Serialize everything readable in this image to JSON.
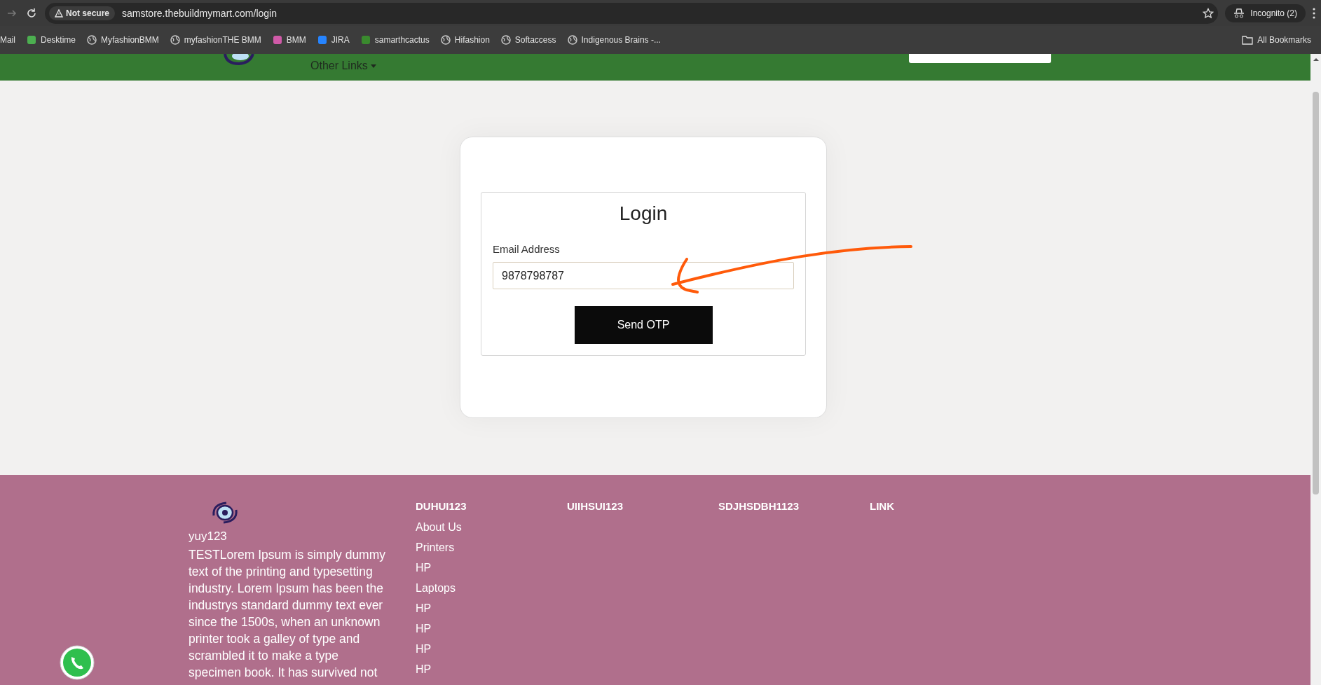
{
  "browser": {
    "security_label": "Not secure",
    "url": "samstore.thebuildmymart.com/login",
    "profile_label": "Incognito (2)",
    "bookmarks": [
      {
        "label": "Mail",
        "kind": "none"
      },
      {
        "label": "Desktime",
        "kind": "favicon",
        "color": "#4caf50"
      },
      {
        "label": "MyfashionBMM",
        "kind": "globe"
      },
      {
        "label": "myfashionTHE BMM",
        "kind": "globe"
      },
      {
        "label": "BMM",
        "kind": "favicon",
        "color": "#d05aa8"
      },
      {
        "label": "JIRA",
        "kind": "favicon",
        "color": "#2684ff"
      },
      {
        "label": "samarthcactus",
        "kind": "favicon",
        "color": "#3a8a2e"
      },
      {
        "label": "Hifashion",
        "kind": "globe"
      },
      {
        "label": "Softaccess",
        "kind": "globe"
      },
      {
        "label": "Indigenous Brains -...",
        "kind": "globe"
      }
    ],
    "all_bookmarks_label": "All Bookmarks"
  },
  "header": {
    "menu_label": "Other Links"
  },
  "login": {
    "title": "Login",
    "email_label": "Email Address",
    "email_value": "9878798787",
    "submit_label": "Send OTP"
  },
  "footer": {
    "brand": "yuy123",
    "description": "TESTLorem Ipsum is simply dummy text of the printing and typesetting industry. Lorem Ipsum has been the industrys standard dummy text ever since the 1500s, when an unknown printer took a galley of type and scrambled it to make a type specimen book. It has survived not",
    "columns": [
      {
        "heading": "DUHUI123",
        "links": [
          "About Us",
          "Printers",
          "HP",
          "Laptops",
          "HP",
          "HP",
          "HP",
          "HP"
        ]
      },
      {
        "heading": "UIIHSUI123"
      },
      {
        "heading": "SDJHSDBH1123"
      },
      {
        "heading": "LINK"
      }
    ]
  }
}
